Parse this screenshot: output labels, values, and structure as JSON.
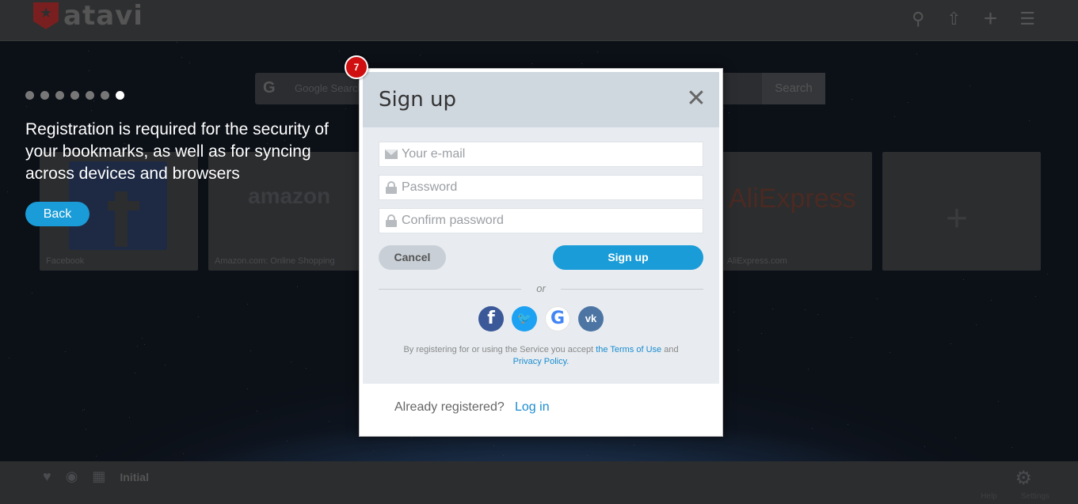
{
  "app": {
    "logo_text": "atavi"
  },
  "background": {
    "search_engine_label": "Google",
    "search_placeholder": "Google Search",
    "search_button": "Search",
    "tiles": [
      {
        "caption": "Facebook"
      },
      {
        "caption": "Amazon.com: Online Shopping",
        "logo_text": "amazon"
      },
      {
        "caption": "AliExpress.com",
        "logo_text": "AliExpress"
      }
    ],
    "bottom_bar": {
      "group_label": "Initial",
      "links": [
        "Help",
        "Settings"
      ]
    }
  },
  "onboarding": {
    "step_total": 7,
    "step_current": 7,
    "step_badge": "7",
    "message": "Registration is required for the security of your bookmarks, as well as for syncing across devices and browsers",
    "back_label": "Back"
  },
  "signup": {
    "title": "Sign up",
    "email_placeholder": "Your e-mail",
    "password_placeholder": "Password",
    "confirm_placeholder": "Confirm password",
    "cancel_label": "Cancel",
    "submit_label": "Sign up",
    "or_label": "or",
    "social": [
      {
        "name": "facebook",
        "glyph": "f"
      },
      {
        "name": "twitter",
        "glyph": "t"
      },
      {
        "name": "google",
        "glyph": "G"
      },
      {
        "name": "vk",
        "glyph": "vk"
      }
    ],
    "terms_prefix": "By registering for or using the Service you accept",
    "terms_link": "the Terms of Use",
    "terms_and": "and",
    "privacy_link": "Privacy Policy.",
    "already_registered": "Already registered?",
    "login_link": "Log in"
  },
  "colors": {
    "accent": "#1a9cd8",
    "badge": "#d01010",
    "link": "#1a8ccf"
  }
}
